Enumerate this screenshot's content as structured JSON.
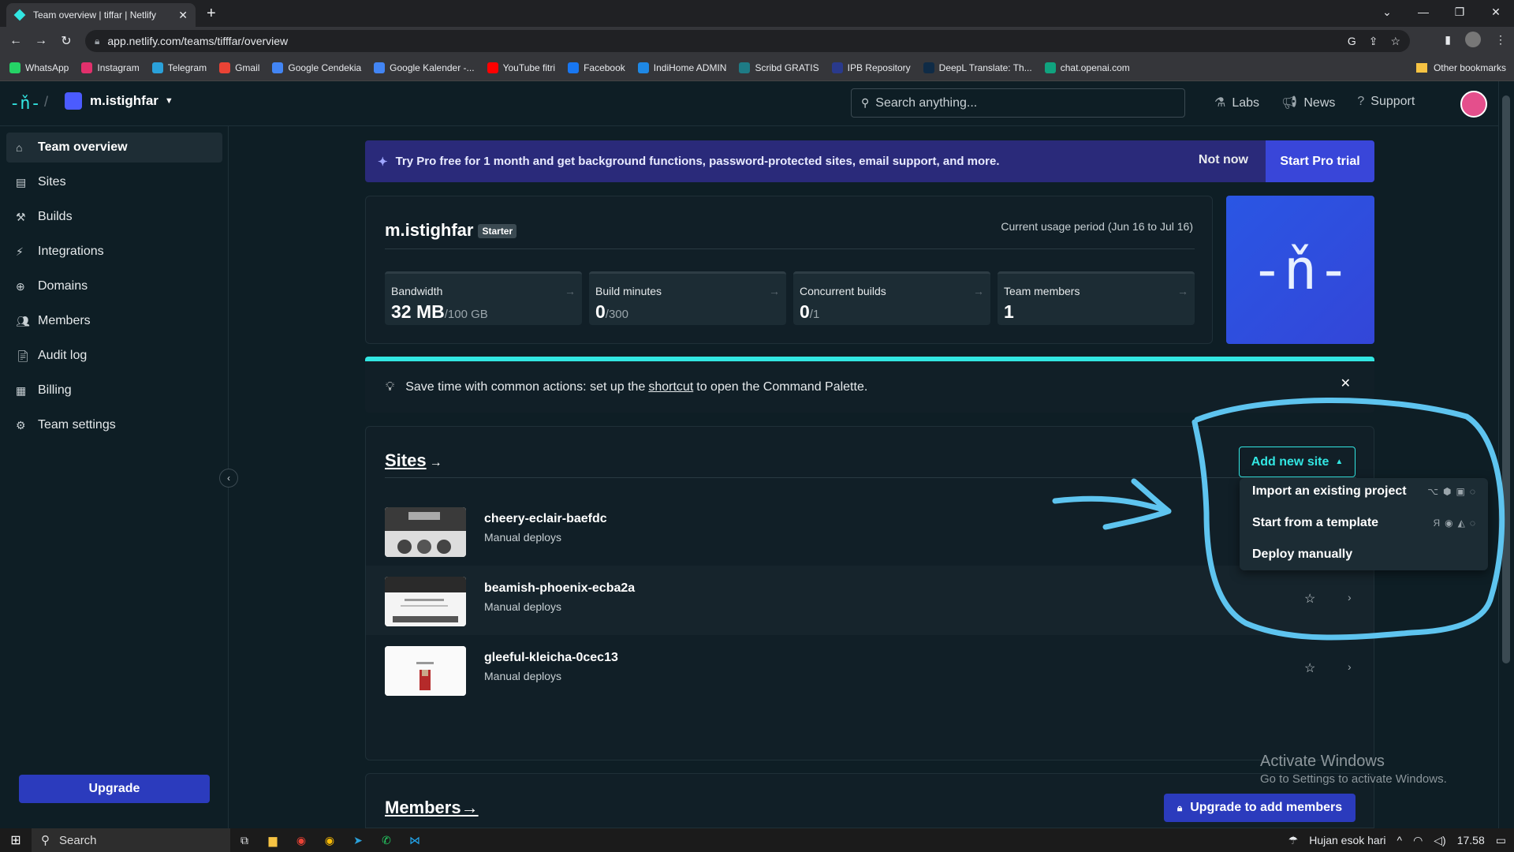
{
  "browser": {
    "tab_title": "Team overview | tiffar | Netlify",
    "url": "app.netlify.com/teams/tifffar/overview",
    "bookmarks": [
      {
        "label": "WhatsApp",
        "color": "#25d366"
      },
      {
        "label": "Instagram",
        "color": "#e1306c"
      },
      {
        "label": "Telegram",
        "color": "#2aa1da"
      },
      {
        "label": "Gmail",
        "color": "#ea4335"
      },
      {
        "label": "Google Cendekia",
        "color": "#4285f4"
      },
      {
        "label": "Google Kalender -...",
        "color": "#4285f4"
      },
      {
        "label": "YouTube fitri",
        "color": "#ff0000"
      },
      {
        "label": "Facebook",
        "color": "#1877f2"
      },
      {
        "label": "IndiHome ADMIN",
        "color": "#1e88e5"
      },
      {
        "label": "Scribd GRATIS",
        "color": "#1e7b85"
      },
      {
        "label": "IPB Repository",
        "color": "#2a3a8c"
      },
      {
        "label": "DeepL Translate: Th...",
        "color": "#0f2b46"
      },
      {
        "label": "chat.openai.com",
        "color": "#10a37f"
      }
    ],
    "other_bookmarks": "Other bookmarks"
  },
  "header": {
    "team_name": "m.istighfar",
    "search_placeholder": "Search anything...",
    "nav": {
      "labs": "Labs",
      "news": "News",
      "support": "Support"
    }
  },
  "sidebar": {
    "items": [
      {
        "label": "Team overview",
        "icon": "home-icon"
      },
      {
        "label": "Sites",
        "icon": "sites-icon"
      },
      {
        "label": "Builds",
        "icon": "builds-icon"
      },
      {
        "label": "Integrations",
        "icon": "integrations-icon"
      },
      {
        "label": "Domains",
        "icon": "globe-icon"
      },
      {
        "label": "Members",
        "icon": "members-icon"
      },
      {
        "label": "Audit log",
        "icon": "audit-icon"
      },
      {
        "label": "Billing",
        "icon": "billing-icon"
      },
      {
        "label": "Team settings",
        "icon": "gear-icon"
      }
    ],
    "upgrade_label": "Upgrade"
  },
  "pro_banner": {
    "text": "Try Pro free for 1 month and get background functions, password-protected sites, email support, and more.",
    "not_now": "Not now",
    "start_trial": "Start Pro trial"
  },
  "usage": {
    "team_name": "m.istighfar",
    "plan": "Starter",
    "period": "Current usage period (Jun 16 to Jul 16)",
    "stats": [
      {
        "label": "Bandwidth",
        "value": "32 MB",
        "limit": "/100 GB"
      },
      {
        "label": "Build minutes",
        "value": "0",
        "limit": "/300"
      },
      {
        "label": "Concurrent builds",
        "value": "0",
        "limit": "/1"
      },
      {
        "label": "Team members",
        "value": "1",
        "limit": ""
      }
    ]
  },
  "tip": {
    "before": "Save time with common actions: set up the",
    "link": "shortcut",
    "after": "to open the Command Palette."
  },
  "sites": {
    "title": "Sites",
    "add_new": "Add new site",
    "list": [
      {
        "name": "cheery-eclair-baefdc",
        "deploy": "Manual deploys"
      },
      {
        "name": "beamish-phoenix-ecba2a",
        "deploy": "Manual deploys"
      },
      {
        "name": "gleeful-kleicha-0cec13",
        "deploy": "Manual deploys"
      }
    ],
    "dropdown": {
      "import": "Import an existing project",
      "template": "Start from a template",
      "manual": "Deploy manually"
    }
  },
  "members": {
    "title": "Members",
    "upgrade_btn": "Upgrade to add members"
  },
  "windows": {
    "activate_title": "Activate Windows",
    "activate_sub": "Go to Settings to activate Windows.",
    "search": "Search",
    "weather": "Hujan esok hari",
    "time": "17.58"
  },
  "colors": {
    "accent": "#32e6e2",
    "annotation": "#5ec4ef",
    "pro": "#3946d9"
  }
}
